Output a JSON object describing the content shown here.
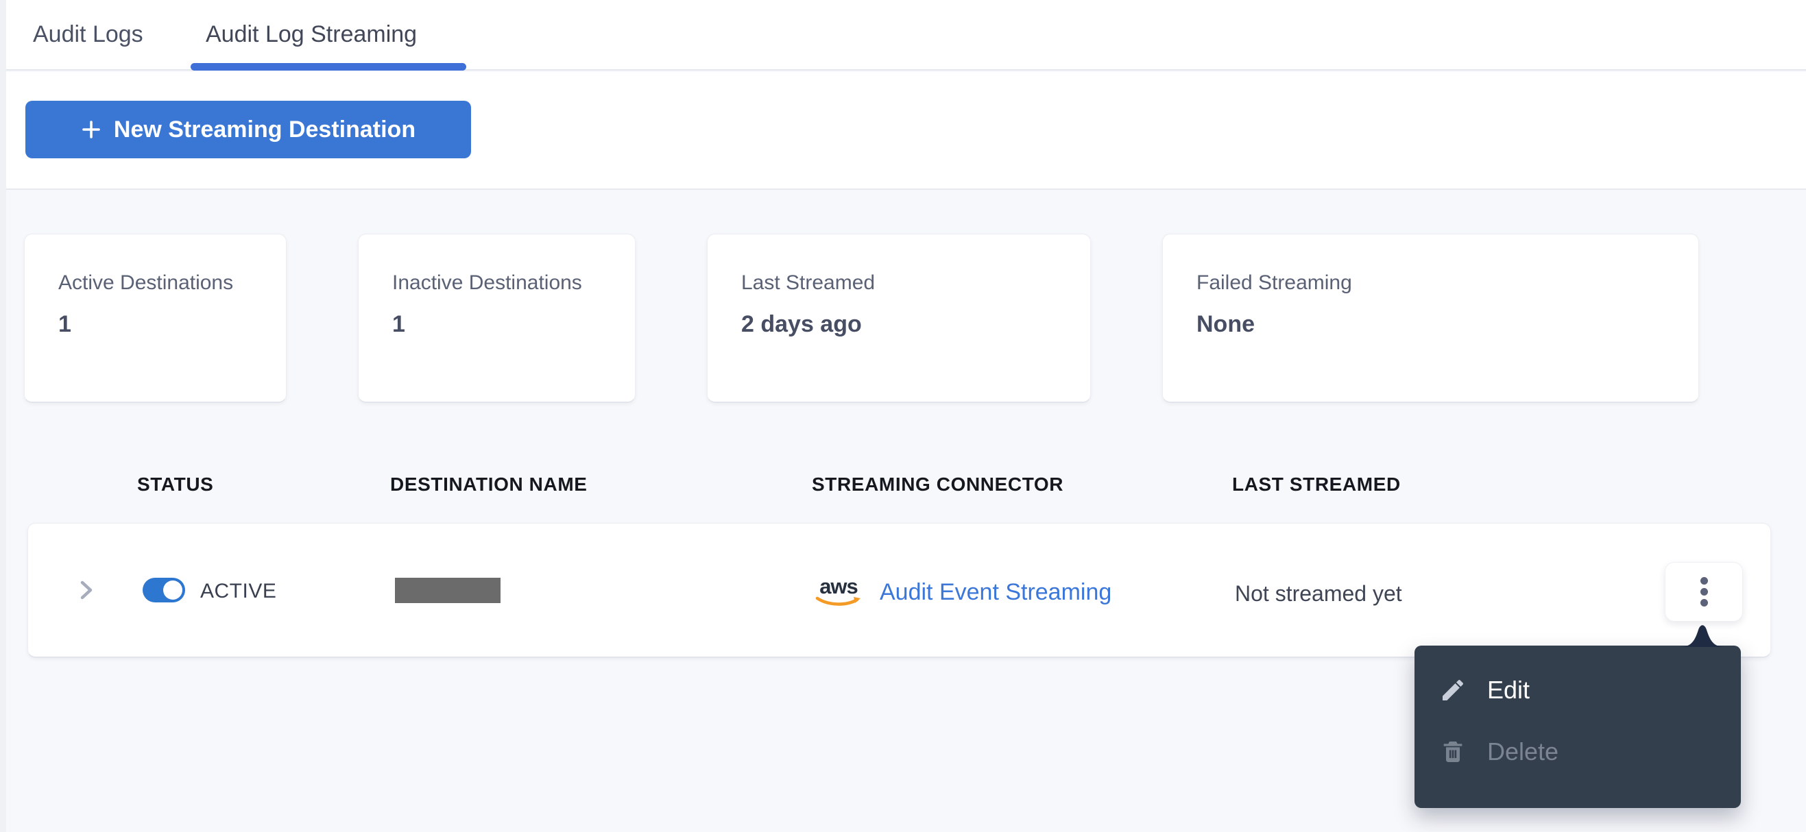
{
  "tabs": {
    "items": [
      {
        "label": "Audit Logs"
      },
      {
        "label": "Audit Log Streaming"
      }
    ],
    "active_index": 1
  },
  "toolbar": {
    "new_destination_button": "New Streaming Destination"
  },
  "stats": [
    {
      "label": "Active Destinations",
      "value": "1"
    },
    {
      "label": "Inactive Destinations",
      "value": "1"
    },
    {
      "label": "Last Streamed",
      "value": "2 days ago"
    },
    {
      "label": "Failed Streaming",
      "value": "None"
    }
  ],
  "table": {
    "columns": [
      "STATUS",
      "DESTINATION NAME",
      "STREAMING CONNECTOR",
      "LAST STREAMED"
    ],
    "rows": [
      {
        "status_toggle": "on",
        "status_label": "ACTIVE",
        "destination_name_redacted": true,
        "connector_icon": "aws-logo",
        "connector_name": "aws",
        "connector_link": "Audit Event Streaming",
        "last_streamed": "Not streamed yet"
      }
    ]
  },
  "context_menu": {
    "items": [
      {
        "label": "Edit",
        "icon": "pencil-icon",
        "enabled": true
      },
      {
        "label": "Delete",
        "icon": "trash-icon",
        "enabled": false
      }
    ]
  },
  "colors": {
    "accent_blue": "#3A76D4",
    "tab_underline_blue": "#3E70D8",
    "toggle_blue": "#2E77D0",
    "link_blue": "#3B76D9",
    "menu_bg": "#333F4D",
    "menu_arrow": "#1F2B43",
    "menu_disabled_text": "#7A8492",
    "redaction_gray": "#6B6B6B",
    "aws_orange": "#F49A26",
    "page_bg": "#F7F8FB"
  }
}
